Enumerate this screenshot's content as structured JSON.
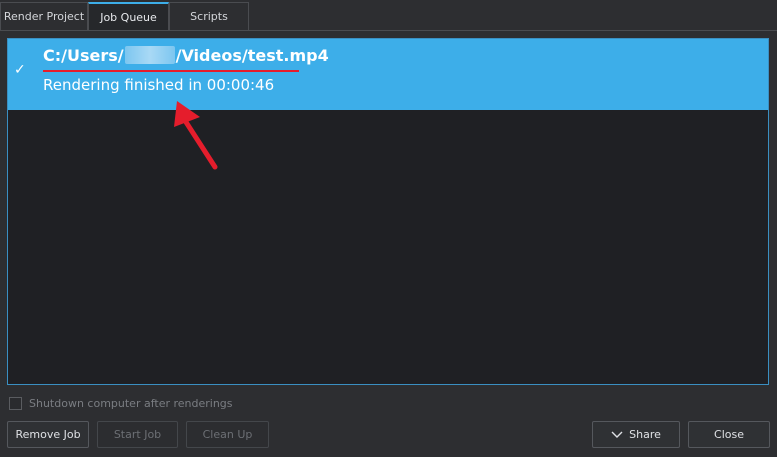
{
  "tabs": [
    {
      "label": "Render Project"
    },
    {
      "label": "Job Queue",
      "active": true
    },
    {
      "label": "Scripts"
    }
  ],
  "job": {
    "path_prefix": "C:/Users/",
    "path_suffix": "/Videos/test.mp4",
    "status": "Rendering finished in 00:00:46"
  },
  "shutdown_option": {
    "label": "Shutdown computer after renderings",
    "checked": false
  },
  "buttons": {
    "remove": "Remove Job",
    "start": "Start Job",
    "clean": "Clean Up",
    "share": "Share",
    "close": "Close"
  },
  "colors": {
    "accent": "#3daee9",
    "annotation_red": "#e51d2c",
    "list_bg": "#1f2024",
    "window_bg": "#2d2e31"
  }
}
